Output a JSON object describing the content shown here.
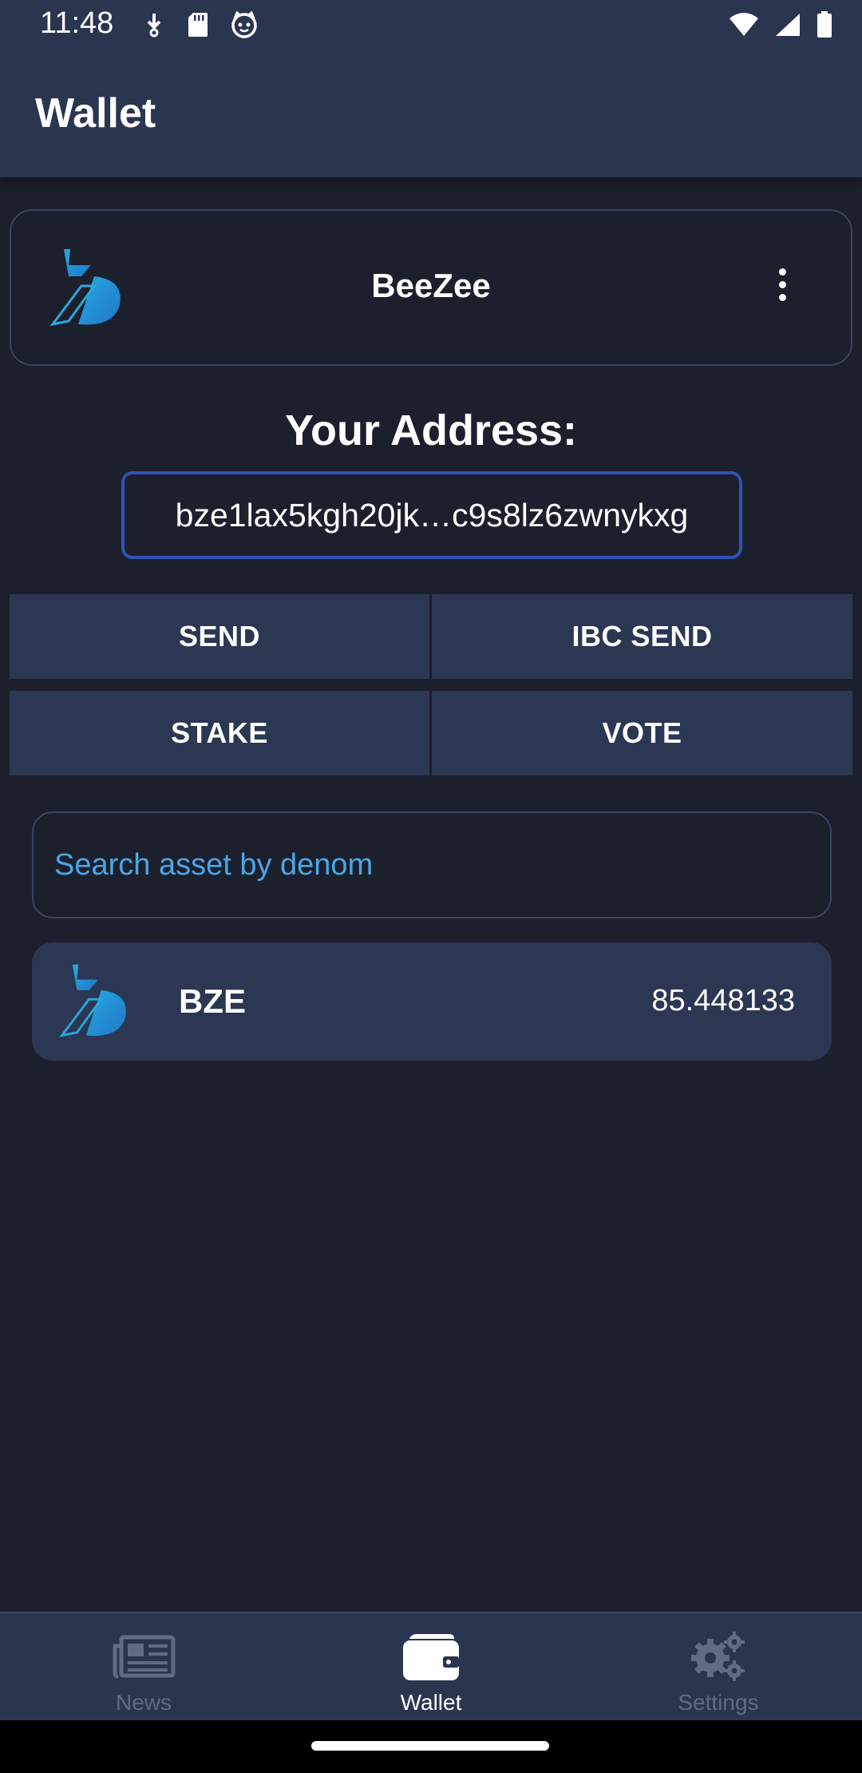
{
  "status_bar": {
    "time": "11:48",
    "left_icons": [
      "download-icon",
      "sd-card-icon",
      "cat-icon"
    ],
    "right_icons": [
      "wifi-icon",
      "signal-icon",
      "battery-icon"
    ]
  },
  "app_bar": {
    "title": "Wallet"
  },
  "wallet_selector": {
    "name": "BeeZee",
    "logo": "bze-logo-icon",
    "menu_icon": "more-vert-icon"
  },
  "address": {
    "title": "Your Address:",
    "value": "bze1lax5kgh20jk…c9s8lz6zwnykxg"
  },
  "actions": {
    "send": "SEND",
    "ibc_send": "IBC SEND",
    "stake": "STAKE",
    "vote": "VOTE"
  },
  "search": {
    "placeholder": "Search asset by denom",
    "value": ""
  },
  "assets": [
    {
      "denom": "BZE",
      "amount": "85.448133",
      "logo": "bze-logo-icon"
    }
  ],
  "bottom_nav": {
    "items": [
      {
        "label": "News",
        "icon": "newspaper-icon",
        "active": false
      },
      {
        "label": "Wallet",
        "icon": "wallet-icon",
        "active": true
      },
      {
        "label": "Settings",
        "icon": "gears-icon",
        "active": false
      }
    ]
  },
  "colors": {
    "background": "#1c202d",
    "bar": "#2a3550",
    "button": "#2b3753",
    "accent": "#4aa6e8",
    "address_border": "#2f52b8"
  }
}
